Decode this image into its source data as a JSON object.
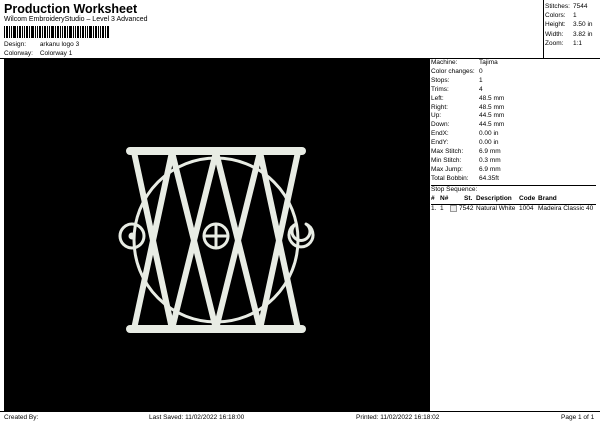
{
  "header": {
    "title": "Production Worksheet",
    "subtitle": "Wilcom EmbroideryStudio – Level 3 Advanced",
    "design_label": "Design:",
    "design_value": "arkanu logo 3",
    "colorway_label": "Colorway:",
    "colorway_value": "Colorway 1"
  },
  "stats": [
    {
      "k": "Stitches:",
      "v": "7544"
    },
    {
      "k": "Colors:",
      "v": "1"
    },
    {
      "k": "Height:",
      "v": "3.50 in"
    },
    {
      "k": "Width:",
      "v": "3.82 in"
    },
    {
      "k": "Zoom:",
      "v": "1:1"
    }
  ],
  "info": [
    {
      "k": "Machine:",
      "v": "Tajima"
    },
    {
      "k": "Color changes:",
      "v": "0"
    },
    {
      "k": "Stops:",
      "v": "1"
    },
    {
      "k": "Trims:",
      "v": "4"
    },
    {
      "k": "Left:",
      "v": "48.5 mm"
    },
    {
      "k": "Right:",
      "v": "48.5 mm"
    },
    {
      "k": "Up:",
      "v": "44.5 mm"
    },
    {
      "k": "Down:",
      "v": "44.5 mm"
    },
    {
      "k": "EndX:",
      "v": "0.00 in"
    },
    {
      "k": "EndY:",
      "v": "0.00 in"
    },
    {
      "k": "Max Stitch:",
      "v": "6.9 mm"
    },
    {
      "k": "Min Stitch:",
      "v": "0.3 mm"
    },
    {
      "k": "Max Jump:",
      "v": "6.9 mm"
    },
    {
      "k": "Total Bobbin:",
      "v": "64.35ft"
    }
  ],
  "sequence": {
    "title": "Stop Sequence:",
    "headers": [
      "#",
      "N#",
      "St.",
      "Description",
      "Code",
      "Brand"
    ],
    "rows": [
      [
        "1.",
        "1",
        "7542",
        "Natural White",
        "1004",
        "Madeira Classic 40"
      ]
    ]
  },
  "footer": {
    "created": "Created By:",
    "saved": "Last Saved: 11/02/2022 16:18:00",
    "printed": "Printed: 11/02/2022 16:18:02",
    "page": "Page 1 of 1"
  },
  "colors": {
    "thread": "#e8ece4",
    "background": "#000000"
  }
}
